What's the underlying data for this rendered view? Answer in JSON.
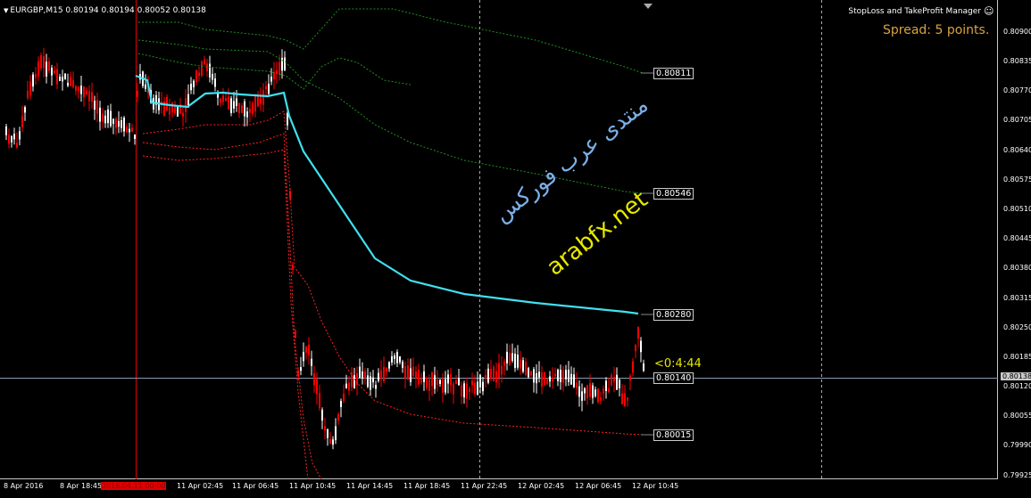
{
  "header": {
    "symbol_line": "EURGBP,M15  0.80194 0.80194 0.80052 0.80138",
    "panel_title": "StopLoss and TakeProfit Manager",
    "spread": "Spread: 5 points."
  },
  "price_axis": [
    "0.80900",
    "0.80835",
    "0.80770",
    "0.80705",
    "0.80640",
    "0.80575",
    "0.80510",
    "0.80445",
    "0.80380",
    "0.80315",
    "0.80250",
    "0.80185",
    "0.80120",
    "0.80055",
    "0.79990",
    "0.79925"
  ],
  "current_price": "0.80138",
  "time_axis": [
    "8 Apr 2016",
    "8 Apr 18:45",
    "2016.04.11 00:00",
    "11 Apr 02:45",
    "11 Apr 06:45",
    "11 Apr 10:45",
    "11 Apr 14:45",
    "11 Apr 18:45",
    "11 Apr 22:45",
    "12 Apr 02:45",
    "12 Apr 06:45",
    "12 Apr 10:45"
  ],
  "levels": [
    "0.80811",
    "0.80546",
    "0.80280",
    "0.80140",
    "0.80015"
  ],
  "countdown": "<0:4:44",
  "watermark": {
    "arabic": "منتدى عرب فوركس",
    "site": "arabfx.net"
  },
  "colors": {
    "background": "#000000",
    "bull": "#ffffff",
    "bear": "#ff0000",
    "ma": "#40e0f0",
    "upper_band": "#1f8f1f",
    "lower_band": "#ff2020",
    "spread": "#d9a341",
    "timer": "#e8e800"
  },
  "icons": {
    "collapse": "triangle-down-icon",
    "panel": "smiley-icon",
    "scroll": "triangle-marker-icon"
  }
}
